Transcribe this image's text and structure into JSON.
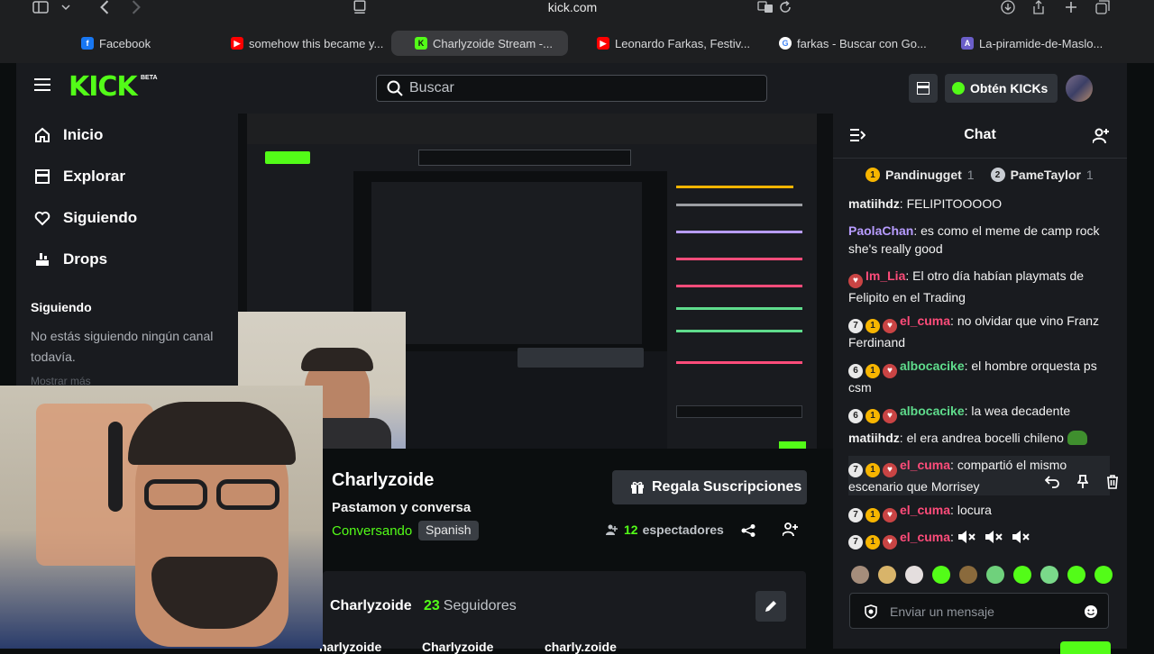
{
  "browser": {
    "url": "kick.com",
    "tabs": [
      {
        "label": "Facebook",
        "color": "#1877f2",
        "glyph": "f"
      },
      {
        "label": "somehow this became y...",
        "color": "#ff0000",
        "glyph": "▶"
      },
      {
        "label": "Charlyzoide Stream -...",
        "color": "#53fc18",
        "glyph": "K"
      },
      {
        "label": "Leonardo Farkas, Festiv...",
        "color": "#ff0000",
        "glyph": "▶"
      },
      {
        "label": "farkas - Buscar con Go...",
        "color": "#4285f4",
        "glyph": "G"
      },
      {
        "label": "La-piramide-de-Maslo...",
        "color": "#6b5ec9",
        "glyph": "A"
      }
    ]
  },
  "header": {
    "logo": "KICK",
    "beta": "BETA",
    "search_placeholder": "Buscar",
    "kicks_label": "Obtén KICKs"
  },
  "sidebar": {
    "items": [
      {
        "label": "Inicio",
        "icon": "home-icon"
      },
      {
        "label": "Explorar",
        "icon": "compass-icon"
      },
      {
        "label": "Siguiendo",
        "icon": "heart-icon"
      },
      {
        "label": "Drops",
        "icon": "drops-icon"
      }
    ],
    "following_title": "Siguiendo",
    "following_empty": "No estás siguiendo ningún canal todavía.",
    "show_more": "Mostrar más"
  },
  "stream": {
    "channel": "Charlyzoide",
    "title": "Pastamon y conversa",
    "category": "Conversando",
    "language": "Spanish",
    "gift_label": "Regala Suscripciones",
    "viewers": "12",
    "viewers_label": "espectadores",
    "followers": "23",
    "followers_label": "Seguidores",
    "socials": [
      "harlyzoide",
      "Charlyzoide",
      "charly.zoide"
    ]
  },
  "chat": {
    "title": "Chat",
    "leaderboard": [
      {
        "rank": "1",
        "name": "Pandinugget",
        "count": "1"
      },
      {
        "rank": "2",
        "name": "PameTaylor",
        "count": "1"
      }
    ],
    "messages": [
      {
        "badges": [],
        "user": "matiihdz",
        "color": "#f2f2f2",
        "text": "FELIPITOOOOO"
      },
      {
        "badges": [],
        "user": "PaolaChan",
        "color": "#b79cff",
        "text": "es como el meme de camp rock she's really good"
      },
      {
        "badges": [
          "mod"
        ],
        "user": "Im_Lia",
        "color": "#ff4c7a",
        "text": "El otro día habían playmats de Felipito en el Trading"
      },
      {
        "badges": [
          "7",
          "1",
          "mod"
        ],
        "user": "el_cuma",
        "color": "#ff4c7a",
        "text": "no olvidar que vino Franz Ferdinand"
      },
      {
        "badges": [
          "6",
          "1",
          "mod"
        ],
        "user": "albocacike",
        "color": "#5fdc8c",
        "text": "el hombre orquesta ps csm"
      },
      {
        "badges": [
          "6",
          "1",
          "mod"
        ],
        "user": "albocacike",
        "color": "#5fdc8c",
        "text": "la wea decadente"
      },
      {
        "badges": [],
        "user": "matiihdz",
        "color": "#f2f2f2",
        "text": "el era andrea bocelli chileno"
      },
      {
        "badges": [
          "7",
          "1",
          "mod"
        ],
        "user": "el_cuma",
        "color": "#ff4c7a",
        "text": "compartió el mismo escenario que Morrisey"
      },
      {
        "badges": [
          "7",
          "1",
          "mod"
        ],
        "user": "el_cuma",
        "color": "#ff4c7a",
        "text": "locura"
      },
      {
        "badges": [
          "7",
          "1",
          "mod"
        ],
        "user": "el_cuma",
        "color": "#ff4c7a",
        "text": ""
      }
    ],
    "input_placeholder": "Enviar un mensaje"
  },
  "colors": {
    "accent": "#53fc18",
    "bg": "#0b0e0f",
    "panel": "#191b1f"
  }
}
